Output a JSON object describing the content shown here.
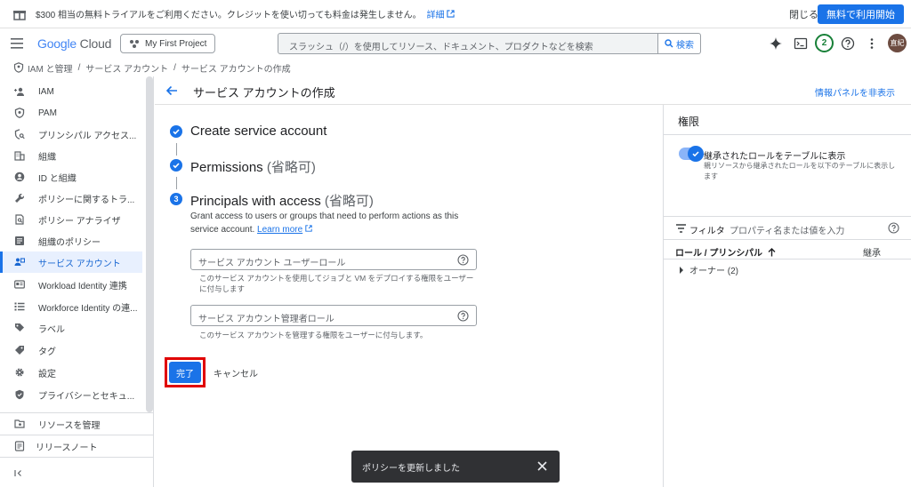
{
  "banner": {
    "text": "$300 相当の無料トライアルをご利用ください。クレジットを使い切っても料金は発生しません。",
    "link": "詳細",
    "close": "閉じる",
    "start": "無料で利用開始"
  },
  "header": {
    "logo_google": "Google",
    "logo_cloud": "Cloud",
    "project": "My First Project",
    "search_placeholder": "スラッシュ（/）を使用してリソース、ドキュメント、プロダクトなどを検索",
    "search_button": "検索",
    "notification_count": "2",
    "avatar": "直紀"
  },
  "breadcrumb": [
    "IAM と管理",
    "サービス アカウント",
    "サービス アカウントの作成"
  ],
  "sidebar": {
    "items": [
      {
        "label": "IAM",
        "icon": "person-add-icon"
      },
      {
        "label": "PAM",
        "icon": "shield-icon"
      },
      {
        "label": "プリンシパル アクセス...",
        "icon": "policy-icon"
      },
      {
        "label": "組織",
        "icon": "building-icon"
      },
      {
        "label": "ID と組織",
        "icon": "account-circle-icon"
      },
      {
        "label": "ポリシーに関するトラ...",
        "icon": "wrench-icon"
      },
      {
        "label": "ポリシー アナライザ",
        "icon": "analyzer-icon"
      },
      {
        "label": "組織のポリシー",
        "icon": "article-icon"
      },
      {
        "label": "サービス アカウント",
        "icon": "service-account-icon"
      },
      {
        "label": "Workload Identity 連携",
        "icon": "id-card-icon"
      },
      {
        "label": "Workforce Identity の連...",
        "icon": "list-icon"
      },
      {
        "label": "ラベル",
        "icon": "label-icon"
      },
      {
        "label": "タグ",
        "icon": "tag-icon"
      },
      {
        "label": "設定",
        "icon": "gear-icon"
      },
      {
        "label": "プライバシーとセキュ...",
        "icon": "privacy-shield-icon"
      }
    ],
    "manage_resources": "リソースを管理",
    "release_notes": "リリースノート"
  },
  "main": {
    "title": "サービス アカウントの作成",
    "hide_panel": "情報パネルを非表示",
    "steps": [
      {
        "title": "Create service account",
        "optional": ""
      },
      {
        "title": "Permissions",
        "optional": "(省略可)"
      },
      {
        "number": "3",
        "title": "Principals with access",
        "optional": "(省略可)"
      }
    ],
    "description": "Grant access to users or groups that need to perform actions as this service account.",
    "learn_more": "Learn more",
    "field1_placeholder": "サービス アカウント ユーザーロール",
    "field1_hint": "このサービス アカウントを使用してジョブと VM をデプロイする権限をユーザーに付与します",
    "field2_placeholder": "サービス アカウント管理者ロール",
    "field2_hint": "このサービス アカウントを管理する権限をユーザーに付与します。",
    "done": "完了",
    "cancel": "キャンセル"
  },
  "panel": {
    "title": "権限",
    "toggle_label": "継承されたロールをテーブルに表示",
    "toggle_sub": "親リソースから継承されたロールを以下のテーブルに表示します",
    "filter": "フィルタ",
    "filter_placeholder": "プロパティ名または値を入力",
    "col_role": "ロール / プリンシパル",
    "col_inherit": "継承",
    "owner_row": "オーナー (2)"
  },
  "toast": {
    "message": "ポリシーを更新しました"
  },
  "colors": {
    "accent": "#1a73e8",
    "highlight": "#e00000"
  }
}
